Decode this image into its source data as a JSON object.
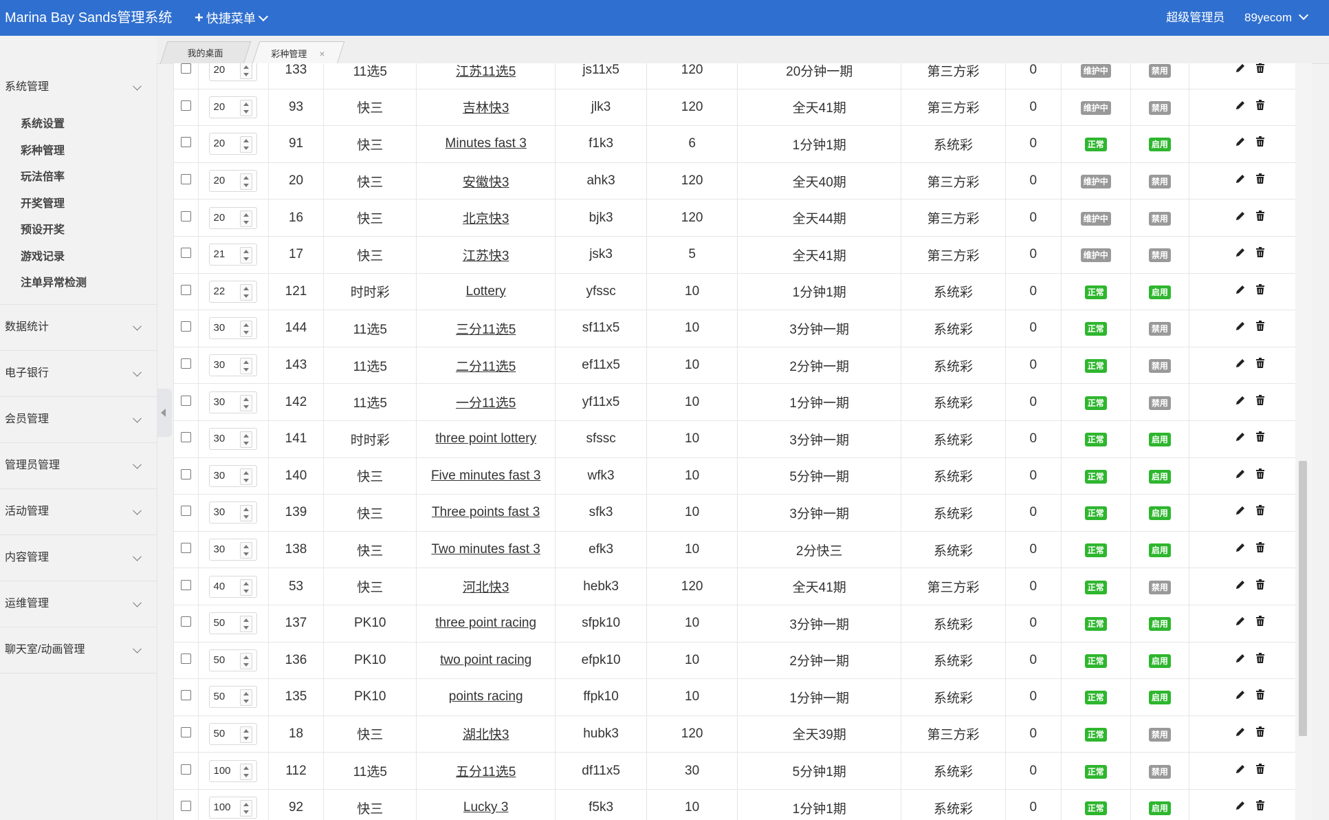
{
  "header": {
    "app_title": "Marina Bay Sands管理系统",
    "quick_menu": "快捷菜单",
    "role": "超级管理员",
    "username": "89yecom"
  },
  "tabs": [
    {
      "label": "我的桌面",
      "closable": false
    },
    {
      "label": "彩种管理",
      "closable": true
    }
  ],
  "sidebar": {
    "groups": [
      {
        "label": "系统管理",
        "expanded": true,
        "items": [
          "系统设置",
          "彩种管理",
          "玩法倍率",
          "开奖管理",
          "预设开奖",
          "游戏记录",
          "注单异常检测"
        ]
      },
      {
        "label": "数据统计"
      },
      {
        "label": "电子银行"
      },
      {
        "label": "会员管理"
      },
      {
        "label": "管理员管理"
      },
      {
        "label": "活动管理"
      },
      {
        "label": "内容管理"
      },
      {
        "label": "运维管理"
      },
      {
        "label": "聊天室/动画管理"
      }
    ]
  },
  "colors": {
    "accent": "#2f6fcf",
    "status_normal": "#2eb62e",
    "status_gray": "#999999"
  },
  "table": {
    "rows": [
      {
        "sort": "20",
        "id": "133",
        "type": "11选5",
        "name": "江苏11选5",
        "code": "js11x5",
        "time": "120",
        "period": "20分钟一期",
        "category": "第三方彩",
        "count": "0",
        "status": "维护中",
        "enable": "禁用"
      },
      {
        "sort": "20",
        "id": "93",
        "type": "快三",
        "name": "吉林快3",
        "code": "jlk3",
        "time": "120",
        "period": "全天41期",
        "category": "第三方彩",
        "count": "0",
        "status": "维护中",
        "enable": "禁用"
      },
      {
        "sort": "20",
        "id": "91",
        "type": "快三",
        "name": "Minutes fast 3",
        "code": "f1k3",
        "time": "6",
        "period": "1分钟1期",
        "category": "系统彩",
        "count": "0",
        "status": "正常",
        "enable": "启用"
      },
      {
        "sort": "20",
        "id": "20",
        "type": "快三",
        "name": "安徽快3",
        "code": "ahk3",
        "time": "120",
        "period": "全天40期",
        "category": "第三方彩",
        "count": "0",
        "status": "维护中",
        "enable": "禁用"
      },
      {
        "sort": "20",
        "id": "16",
        "type": "快三",
        "name": "北京快3",
        "code": "bjk3",
        "time": "120",
        "period": "全天44期",
        "category": "第三方彩",
        "count": "0",
        "status": "维护中",
        "enable": "禁用"
      },
      {
        "sort": "21",
        "id": "17",
        "type": "快三",
        "name": "江苏快3",
        "code": "jsk3",
        "time": "5",
        "period": "全天41期",
        "category": "第三方彩",
        "count": "0",
        "status": "维护中",
        "enable": "禁用"
      },
      {
        "sort": "22",
        "id": "121",
        "type": "时时彩",
        "name": "Lottery",
        "code": "yfssc",
        "time": "10",
        "period": "1分钟1期",
        "category": "系统彩",
        "count": "0",
        "status": "正常",
        "enable": "启用"
      },
      {
        "sort": "30",
        "id": "144",
        "type": "11选5",
        "name": "三分11选5",
        "code": "sf11x5",
        "time": "10",
        "period": "3分钟一期",
        "category": "系统彩",
        "count": "0",
        "status": "正常",
        "enable": "禁用"
      },
      {
        "sort": "30",
        "id": "143",
        "type": "11选5",
        "name": "二分11选5",
        "code": "ef11x5",
        "time": "10",
        "period": "2分钟一期",
        "category": "系统彩",
        "count": "0",
        "status": "正常",
        "enable": "禁用"
      },
      {
        "sort": "30",
        "id": "142",
        "type": "11选5",
        "name": "一分11选5",
        "code": "yf11x5",
        "time": "10",
        "period": "1分钟一期",
        "category": "系统彩",
        "count": "0",
        "status": "正常",
        "enable": "禁用"
      },
      {
        "sort": "30",
        "id": "141",
        "type": "时时彩",
        "name": "three point lottery",
        "code": "sfssc",
        "time": "10",
        "period": "3分钟一期",
        "category": "系统彩",
        "count": "0",
        "status": "正常",
        "enable": "启用"
      },
      {
        "sort": "30",
        "id": "140",
        "type": "快三",
        "name": "Five minutes fast 3",
        "code": "wfk3",
        "time": "10",
        "period": "5分钟一期",
        "category": "系统彩",
        "count": "0",
        "status": "正常",
        "enable": "启用"
      },
      {
        "sort": "30",
        "id": "139",
        "type": "快三",
        "name": "Three points fast 3",
        "code": "sfk3",
        "time": "10",
        "period": "3分钟一期",
        "category": "系统彩",
        "count": "0",
        "status": "正常",
        "enable": "启用"
      },
      {
        "sort": "30",
        "id": "138",
        "type": "快三",
        "name": "Two minutes fast 3",
        "code": "efk3",
        "time": "10",
        "period": "2分快三",
        "category": "系统彩",
        "count": "0",
        "status": "正常",
        "enable": "启用"
      },
      {
        "sort": "40",
        "id": "53",
        "type": "快三",
        "name": "河北快3",
        "code": "hebk3",
        "time": "120",
        "period": "全天41期",
        "category": "第三方彩",
        "count": "0",
        "status": "正常",
        "enable": "禁用"
      },
      {
        "sort": "50",
        "id": "137",
        "type": "PK10",
        "name": "three point racing",
        "code": "sfpk10",
        "time": "10",
        "period": "3分钟一期",
        "category": "系统彩",
        "count": "0",
        "status": "正常",
        "enable": "启用"
      },
      {
        "sort": "50",
        "id": "136",
        "type": "PK10",
        "name": "two point racing",
        "code": "efpk10",
        "time": "10",
        "period": "2分钟一期",
        "category": "系统彩",
        "count": "0",
        "status": "正常",
        "enable": "启用"
      },
      {
        "sort": "50",
        "id": "135",
        "type": "PK10",
        "name": "points racing",
        "code": "ffpk10",
        "time": "10",
        "period": "1分钟一期",
        "category": "系统彩",
        "count": "0",
        "status": "正常",
        "enable": "启用"
      },
      {
        "sort": "50",
        "id": "18",
        "type": "快三",
        "name": "湖北快3",
        "code": "hubk3",
        "time": "120",
        "period": "全天39期",
        "category": "第三方彩",
        "count": "0",
        "status": "正常",
        "enable": "禁用"
      },
      {
        "sort": "100",
        "id": "112",
        "type": "11选5",
        "name": "五分11选5",
        "code": "df11x5",
        "time": "30",
        "period": "5分钟1期",
        "category": "系统彩",
        "count": "0",
        "status": "正常",
        "enable": "禁用"
      },
      {
        "sort": "100",
        "id": "92",
        "type": "快三",
        "name": "Lucky 3",
        "code": "f5k3",
        "time": "10",
        "period": "1分钟1期",
        "category": "系统彩",
        "count": "0",
        "status": "正常",
        "enable": "启用"
      }
    ]
  }
}
